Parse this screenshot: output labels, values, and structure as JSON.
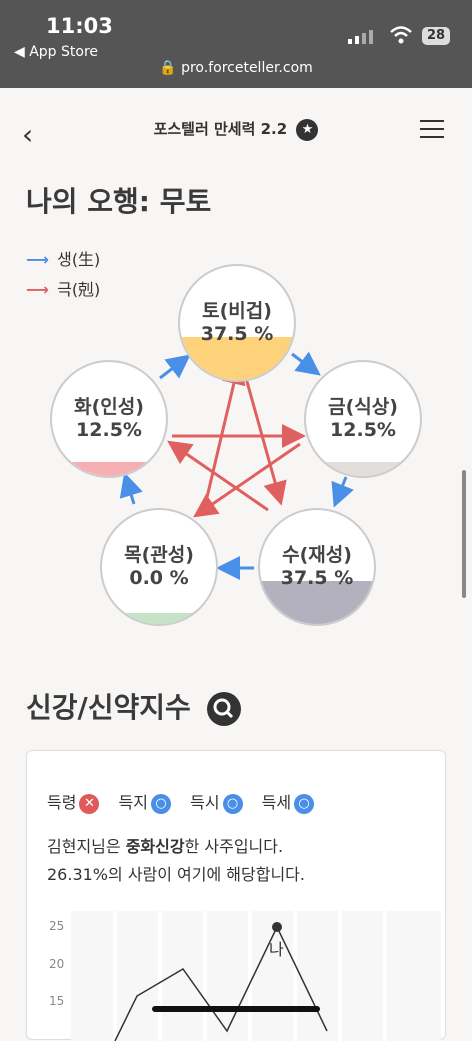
{
  "status": {
    "time": "11:03",
    "back_app": "◀ App Store",
    "url": "pro.forceteller.com",
    "battery": "28"
  },
  "header": {
    "title": "포스텔러 만세력 2.2",
    "star": "★"
  },
  "five_elements": {
    "title": "나의 오행: 무토",
    "legend": [
      {
        "arrow": "⟶",
        "label": "생(生)",
        "color": "#4a8fe7"
      },
      {
        "arrow": "⟶",
        "label": "극(剋)",
        "color": "#e06060"
      }
    ],
    "elements": [
      {
        "label": "토(비겁)",
        "value": "37.5 %",
        "fraction": 0.375,
        "fill_color": "#fdd27a"
      },
      {
        "label": "금(식상)",
        "value": "12.5%",
        "fraction": 0.125,
        "fill_color": "#e2dedb"
      },
      {
        "label": "수(재성)",
        "value": "37.5 %",
        "fraction": 0.375,
        "fill_color": "#b3b1bd"
      },
      {
        "label": "목(관성)",
        "value": "0.0 %",
        "fraction": 0.0,
        "fill_color": "#c7e3c7"
      },
      {
        "label": "화(인성)",
        "value": "12.5%",
        "fraction": 0.125,
        "fill_color": "#f6b0b4"
      }
    ]
  },
  "strength": {
    "title": "신강/신약지수",
    "chips": [
      {
        "label": "득령",
        "mark": "✕",
        "color": "#e05a5a"
      },
      {
        "label": "득지",
        "mark": "○",
        "color": "#4a8fe7"
      },
      {
        "label": "득시",
        "mark": "○",
        "color": "#4a8fe7"
      },
      {
        "label": "득세",
        "mark": "○",
        "color": "#4a8fe7"
      }
    ],
    "desc_pre": "김현지님은 ",
    "desc_bold": "중화신강",
    "desc_post": "한 사주입니다.",
    "desc_line2": "26.31%의 사람이 여기에 해당합니다.",
    "y_ticks": [
      "25",
      "20",
      "15"
    ],
    "marker_label": "나"
  }
}
